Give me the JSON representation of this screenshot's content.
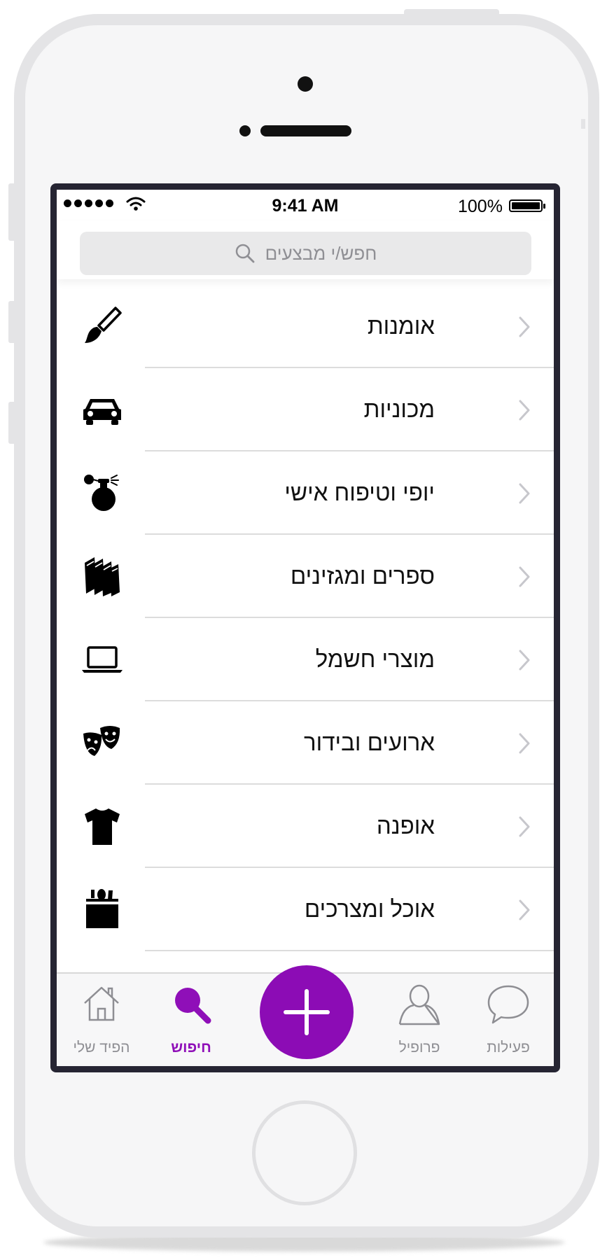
{
  "status_bar": {
    "time": "9:41 AM",
    "battery": "100%"
  },
  "search": {
    "placeholder": "חפש/י מבצעים"
  },
  "categories": [
    {
      "label": "אומנות",
      "icon": "paintbrush-icon"
    },
    {
      "label": "מכוניות",
      "icon": "car-icon"
    },
    {
      "label": "יופי וטיפוח אישי",
      "icon": "perfume-icon"
    },
    {
      "label": "ספרים ומגזינים",
      "icon": "books-icon"
    },
    {
      "label": "מוצרי חשמל",
      "icon": "laptop-icon"
    },
    {
      "label": "ארועים ובידור",
      "icon": "theater-masks-icon"
    },
    {
      "label": "אופנה",
      "icon": "tshirt-icon"
    },
    {
      "label": "אוכל ומצרכים",
      "icon": "grocery-bag-icon"
    }
  ],
  "tab_bar": {
    "tabs": [
      {
        "label": "הפיד שלי",
        "icon": "home-icon",
        "active": false
      },
      {
        "label": "חיפוש",
        "icon": "search-icon",
        "active": true
      },
      {
        "label": "פרופיל",
        "icon": "person-icon",
        "active": false
      },
      {
        "label": "פעילות",
        "icon": "speech-bubble-icon",
        "active": false
      }
    ],
    "add_button_icon": "plus-icon"
  },
  "colors": {
    "accent": "#8c0cb5",
    "screen_border": "#262533",
    "separator": "#dcdcdc"
  }
}
